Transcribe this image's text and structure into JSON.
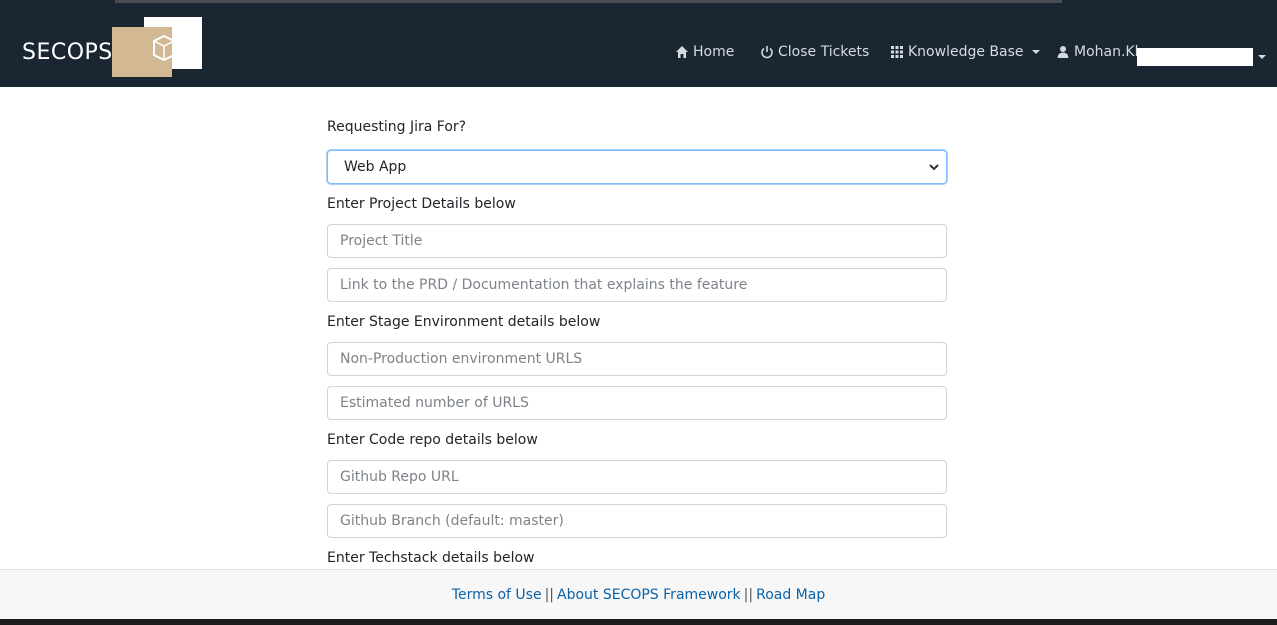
{
  "header": {
    "logo_text": "SECOPS",
    "nav": {
      "home": "Home",
      "close_tickets": "Close Tickets",
      "knowledge_base": "Knowledge Base",
      "user": "Mohan.Kk"
    }
  },
  "form": {
    "request_label": "Requesting Jira For?",
    "request_selected": "Web App",
    "project_section": "Enter Project Details below",
    "project_title_placeholder": "Project Title",
    "prd_link_placeholder": "Link to the PRD / Documentation that explains the feature",
    "stage_section": "Enter Stage Environment details below",
    "nonprod_urls_placeholder": "Non-Production environment URLS",
    "url_count_placeholder": "Estimated number of URLS",
    "repo_section": "Enter Code repo details below",
    "repo_url_placeholder": "Github Repo URL",
    "repo_branch_placeholder": "Github Branch (default: master)",
    "techstack_section": "Enter Techstack details below"
  },
  "footer": {
    "terms": "Terms of Use",
    "separator": "||",
    "about": "About SECOPS Framework",
    "roadmap": "Road Map"
  },
  "colors": {
    "navbar": "#1a2733",
    "logo_accent": "#d3b993",
    "link": "#0b62a8"
  }
}
